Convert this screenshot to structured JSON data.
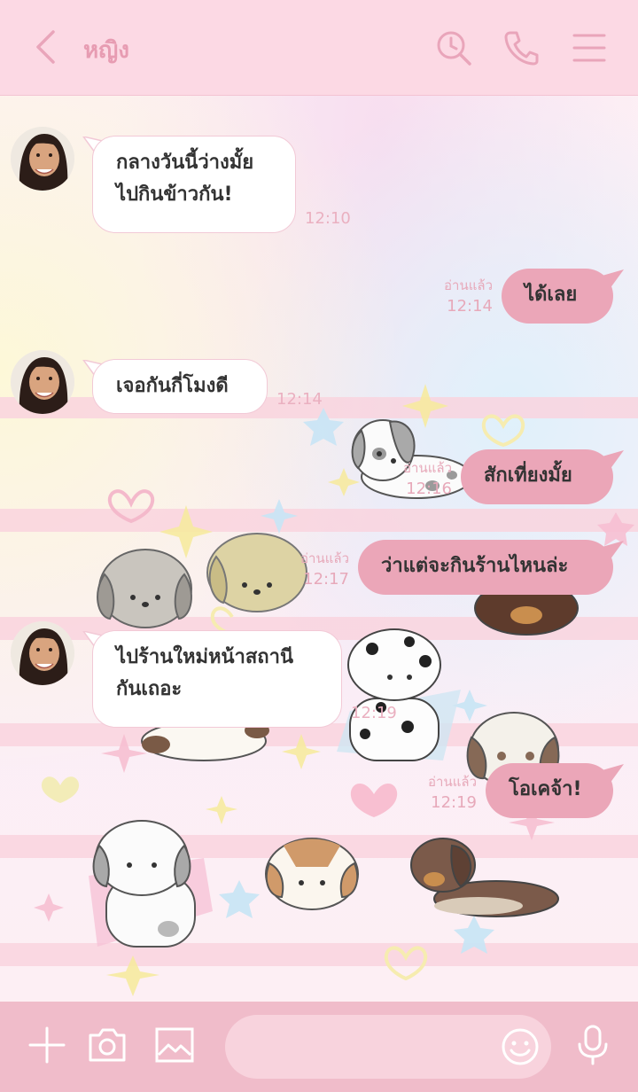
{
  "header": {
    "title": "หญิง",
    "icons": [
      "back-icon",
      "search-clock-icon",
      "phone-icon",
      "menu-icon"
    ]
  },
  "messages": [
    {
      "side": "left",
      "lines": [
        "กลางวันนี้ว่างมั้ย",
        "ไปกินข้าวกัน!"
      ],
      "time": "12:10"
    },
    {
      "side": "right",
      "text": "ได้เลย",
      "read": "อ่านแล้ว",
      "time": "12:14"
    },
    {
      "side": "left",
      "lines": [
        "เจอกันกี่โมงดี"
      ],
      "time": "12:14"
    },
    {
      "side": "right",
      "text": "สักเที่ยงมั้ย",
      "read": "อ่านแล้ว",
      "time": "12:16"
    },
    {
      "side": "right",
      "text": "ว่าแต่จะกินร้านไหนล่ะ",
      "read": "อ่านแล้ว",
      "time": "12:17"
    },
    {
      "side": "left",
      "lines": [
        "ไปร้านใหม่หน้าสถานี",
        "กันเถอะ"
      ],
      "time": "12:19"
    },
    {
      "side": "right",
      "text": "โอเคจ้า!",
      "read": "อ่านแล้ว",
      "time": "12:19"
    }
  ],
  "footer": {
    "icons": [
      "plus-icon",
      "camera-icon",
      "image-icon",
      "emoji-icon",
      "microphone-icon"
    ],
    "input_placeholder": ""
  },
  "colors": {
    "header_bg": "#fcd9e4",
    "accent": "#e79cb2",
    "right_bubble": "#eba6b8",
    "footer_bg": "#f0bcca"
  }
}
